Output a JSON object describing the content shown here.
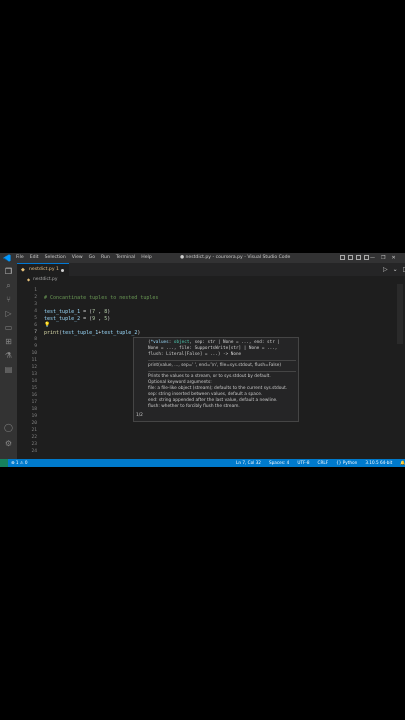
{
  "titlebar": {
    "menu": [
      "File",
      "Edit",
      "Selection",
      "View",
      "Go",
      "Run",
      "Terminal",
      "Help"
    ],
    "title": "● nestdict.py - coursera.py - Visual Studio Code",
    "controls": [
      "—",
      "❐",
      "✕"
    ]
  },
  "tab": {
    "label": "nestdict.py 1"
  },
  "breadcrumb": {
    "label": "nestdict.py"
  },
  "editor": {
    "line_numbers": [
      "1",
      "2",
      "3",
      "4",
      "5",
      "6",
      "7",
      "8",
      "9",
      "10",
      "11",
      "12",
      "13",
      "14",
      "15",
      "16",
      "17",
      "18",
      "19",
      "20",
      "21",
      "22",
      "23",
      "24"
    ],
    "active_line": 7,
    "code": {
      "line2": "# Concantinate tuples to nested tuples",
      "line4_var": "test_tuple_1",
      "line4_rest": " = (",
      "line4_a": "7",
      "line4_sep": " , ",
      "line4_b": "8",
      "line4_end": ")",
      "line5_var": "test_tuple_2",
      "line5_rest": " = (",
      "line5_a": "9",
      "line5_sep": " , ",
      "line5_b": "5",
      "line5_end": ")",
      "line7_fn": "print",
      "line7_open": "(",
      "line7_arg1": "test_tuple_1",
      "line7_plus": "+",
      "line7_arg2": "test_tuple_2",
      "line7_close": ")"
    }
  },
  "hover": {
    "sig1a": "(",
    "sig1b": "*values",
    "sig1c": ": ",
    "sig1d": "object",
    "sig1e": ", sep: str | None = ..., end: str |",
    "sig2": "None = ..., file: SupportsWrite[str] | None = ...,",
    "sig3": "flush: Literal[False] = ...) -> None",
    "usage": "print(value, ..., sep=' ', end='\\n', file=sys.stdout, flush=False)",
    "doc1": "Prints the values to a stream, or to sys.stdout by default.",
    "doc2": "Optional keyword arguments:",
    "doc3": "file: a file-like object (stream); defaults to the current sys.stdout.",
    "doc4": "sep: string inserted between values, default a space.",
    "doc5": "end: string appended after the last value, default a newline.",
    "doc6": "flush: whether to forcibly flush the stream.",
    "counter": "1/2"
  },
  "statusbar": {
    "left": "⊗ 1 ⚠ 0",
    "items": [
      "Ln 7, Col 32",
      "Spaces: 4",
      "UTF-8",
      "CRLF",
      "{} Python",
      "3.10.5 64-bit",
      "🔔"
    ]
  },
  "colors": {
    "accent": "#007acc",
    "editor_bg": "#1e1e1e"
  }
}
